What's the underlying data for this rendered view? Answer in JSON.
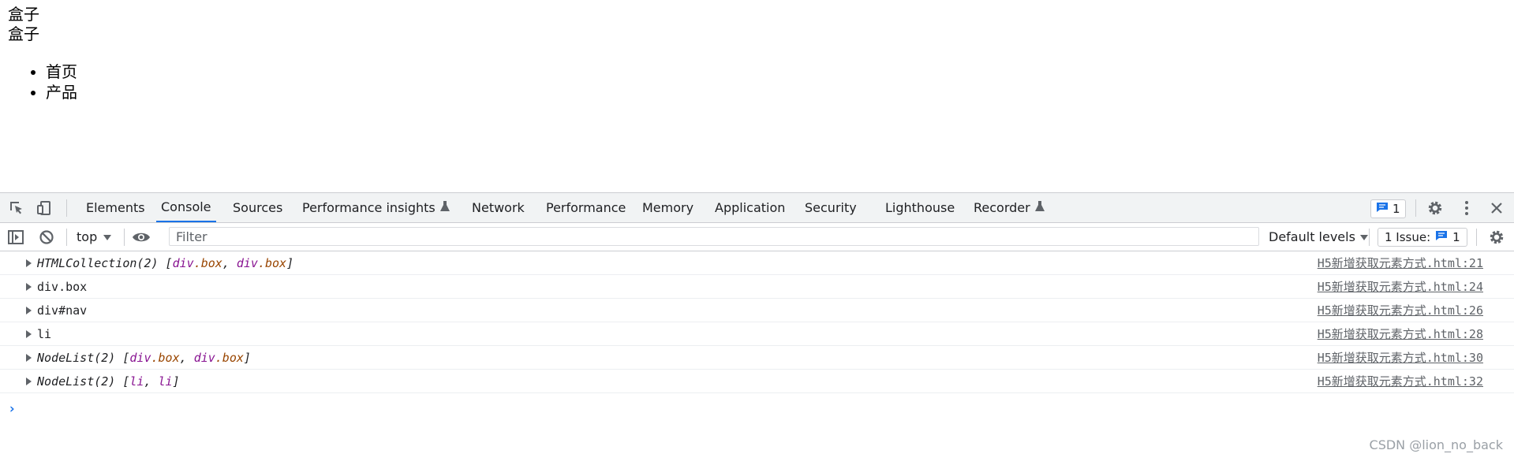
{
  "page": {
    "boxes": [
      "盒子",
      "盒子"
    ],
    "nav_items": [
      "首页",
      "产品"
    ]
  },
  "devtools": {
    "tabs": [
      {
        "label": "Elements",
        "experimental": false,
        "active": false
      },
      {
        "label": "Console",
        "experimental": false,
        "active": true
      },
      {
        "label": "Sources",
        "experimental": false,
        "active": false
      },
      {
        "label": "Performance insights",
        "experimental": true,
        "active": false
      },
      {
        "label": "Network",
        "experimental": false,
        "active": false
      },
      {
        "label": "Performance",
        "experimental": false,
        "active": false
      },
      {
        "label": "Memory",
        "experimental": false,
        "active": false
      },
      {
        "label": "Application",
        "experimental": false,
        "active": false
      },
      {
        "label": "Security",
        "experimental": false,
        "active": false
      },
      {
        "label": "Lighthouse",
        "experimental": false,
        "active": false
      },
      {
        "label": "Recorder",
        "experimental": true,
        "active": false
      }
    ],
    "message_badge_count": "1",
    "toolbar": {
      "context": "top",
      "filter_placeholder": "Filter",
      "levels": "Default levels",
      "issues_label": "1 Issue:",
      "issues_count": "1"
    },
    "console_rows": [
      {
        "parts": [
          {
            "t": "HTMLCollection(2) [",
            "k": "it"
          },
          {
            "t": "div",
            "k": "p"
          },
          {
            "t": ".box",
            "k": "c"
          },
          {
            "t": ", ",
            "k": "it"
          },
          {
            "t": "div",
            "k": "p"
          },
          {
            "t": ".box",
            "k": "c"
          },
          {
            "t": "]",
            "k": "it"
          }
        ],
        "source": "H5新增获取元素方式.html:21"
      },
      {
        "parts": [
          {
            "t": "div.box",
            "k": ""
          }
        ],
        "source": "H5新增获取元素方式.html:24"
      },
      {
        "parts": [
          {
            "t": "div#nav",
            "k": ""
          }
        ],
        "source": "H5新增获取元素方式.html:26"
      },
      {
        "parts": [
          {
            "t": "li",
            "k": ""
          }
        ],
        "source": "H5新增获取元素方式.html:28"
      },
      {
        "parts": [
          {
            "t": "NodeList(2) [",
            "k": "it"
          },
          {
            "t": "div",
            "k": "p"
          },
          {
            "t": ".box",
            "k": "c"
          },
          {
            "t": ", ",
            "k": "it"
          },
          {
            "t": "div",
            "k": "p"
          },
          {
            "t": ".box",
            "k": "c"
          },
          {
            "t": "]",
            "k": "it"
          }
        ],
        "source": "H5新增获取元素方式.html:30"
      },
      {
        "parts": [
          {
            "t": "NodeList(2) [",
            "k": "it"
          },
          {
            "t": "li",
            "k": "p"
          },
          {
            "t": ", ",
            "k": "it"
          },
          {
            "t": "li",
            "k": "p"
          },
          {
            "t": "]",
            "k": "it"
          }
        ],
        "source": "H5新增获取元素方式.html:32"
      }
    ],
    "prompt": "›"
  },
  "watermark": "CSDN @lion_no_back",
  "colors": {
    "accent": "#1a73e8",
    "tag": "#881391",
    "class": "#994500"
  }
}
